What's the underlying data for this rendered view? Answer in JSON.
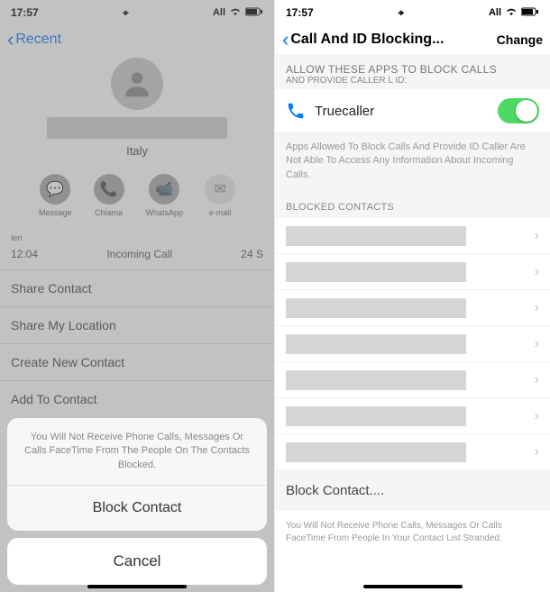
{
  "status": {
    "time": "17:57",
    "carrier": "All",
    "location_icon": "⌖"
  },
  "left": {
    "nav_back": "Recent",
    "country": "Italy",
    "actions": {
      "message": "Message",
      "call": "Chiama",
      "whatsapp": "WhatsApp",
      "email": "e-mail"
    },
    "info": {
      "label": "Ieri",
      "time": "12:04",
      "type": "Incoming Call",
      "duration": "24 S"
    },
    "rows": {
      "share_contact": "Share Contact",
      "share_location": "Share My Location",
      "create_contact": "Create New Contact",
      "add_contact": "Add To Contact"
    },
    "sheet": {
      "message": "You Will Not Receive Phone Calls, Messages Or Calls FaceTime From The People On The Contacts Blocked.",
      "block": "Block Contact",
      "cancel": "Cancel"
    }
  },
  "right": {
    "nav_title": "Call And ID Blocking...",
    "nav_change": "Change",
    "section_title": "ALLOW THESE APPS TO BLOCK CALLS",
    "section_sub": "AND PROVIDE CALLER L ID:",
    "app_name": "Truecaller",
    "app_desc": "Apps Allowed To Block Calls And Provide ID Caller Are Not Able To Access Any Information About Incoming Calls.",
    "blocked_header": "BLOCKED CONTACTS",
    "blocked_items": [
      "",
      "",
      "",
      "",
      "",
      "",
      ""
    ],
    "block_contact": "Block Contact....",
    "footer": "You Will Not Receive Phone Calls, Messages Or Calls FaceTime From People In Your Contact List Stranded."
  }
}
